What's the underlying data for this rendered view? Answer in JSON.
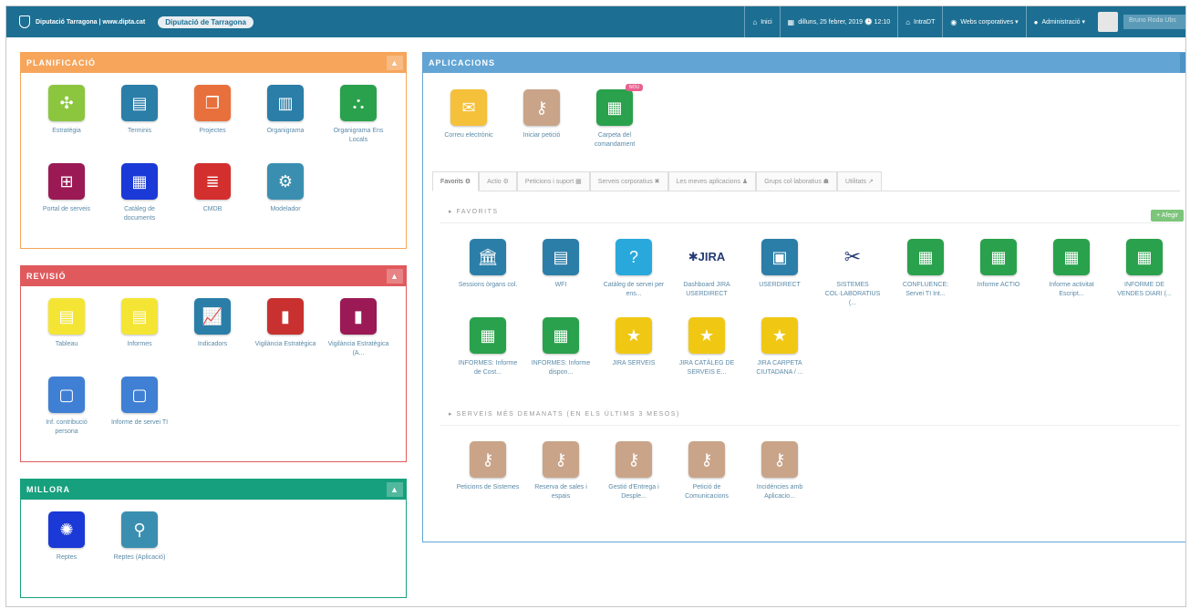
{
  "topbar": {
    "site_title": "Diputació Tarragona | www.dipta.cat",
    "pill": "Diputació de Tarragona",
    "nav": [
      {
        "icon": "home-icon",
        "label": "Inici"
      },
      {
        "icon": "calendar-icon",
        "label": "dilluns, 25 febrer, 2019 🕒 12:10"
      },
      {
        "icon": "home-icon",
        "label": "IntraDT"
      },
      {
        "icon": "globe-icon",
        "label": "Webs corporatives ▾"
      },
      {
        "icon": "user-icon",
        "label": "Administració ▾"
      }
    ],
    "user_name": "Bruno Roda Ubs"
  },
  "planificacio": {
    "title": "PLANIFICACIÓ",
    "items": [
      {
        "label": "Estratègia",
        "color": "#8cc63f",
        "icon": "✣"
      },
      {
        "label": "Terminis",
        "color": "#2b7ea8",
        "icon": "▤"
      },
      {
        "label": "Projectes",
        "color": "#e8703c",
        "icon": "❐"
      },
      {
        "label": "Organigrama",
        "color": "#2b7ea8",
        "icon": "▥"
      },
      {
        "label": "Organigrama Ens Locals",
        "color": "#2aa14c",
        "icon": "⛬"
      },
      {
        "label": "Portal de serveis",
        "color": "#9b1a55",
        "icon": "⊞"
      },
      {
        "label": "Catàleg de documents",
        "color": "#1a39d6",
        "icon": "▦"
      },
      {
        "label": "CMDB",
        "color": "#d42f2f",
        "icon": "≣"
      },
      {
        "label": "Modelador",
        "color": "#3a8fb0",
        "icon": "⚙"
      }
    ]
  },
  "revisio": {
    "title": "REVISIÓ",
    "items": [
      {
        "label": "Tableau",
        "color": "#f4e534",
        "icon": "▤"
      },
      {
        "label": "Informes",
        "color": "#f4e534",
        "icon": "▤"
      },
      {
        "label": "Indicadors",
        "color": "#2b7ea8",
        "icon": "📈"
      },
      {
        "label": "Vigilància Estratègica",
        "color": "#c8312f",
        "icon": "▮"
      },
      {
        "label": "Vigilància Estratègica (A...",
        "color": "#9b1a55",
        "icon": "▮"
      },
      {
        "label": "Inf. contribució persona",
        "color": "#3f7fd4",
        "icon": "▢"
      },
      {
        "label": "Informe de servei TI",
        "color": "#3f7fd4",
        "icon": "▢"
      }
    ]
  },
  "millora": {
    "title": "MILLORA",
    "items": [
      {
        "label": "Reptes",
        "color": "#1a39d6",
        "icon": "✺"
      },
      {
        "label": "Reptes (Aplicació)",
        "color": "#3a8fb0",
        "icon": "⚲"
      }
    ]
  },
  "aplicacions": {
    "title": "APLICACIONS",
    "top": [
      {
        "label": "Correu electrònic",
        "color": "#f5c03a",
        "icon": "✉"
      },
      {
        "label": "Iniciar petició",
        "color": "#c9a489",
        "icon": "⚷"
      },
      {
        "label": "Carpeta del comandament",
        "color": "#2aa14c",
        "icon": "▦",
        "badge": "NOU"
      }
    ],
    "tabs": [
      "Favorits ⚙",
      "Actio ⚙",
      "Peticions i suport ▦",
      "Serveis corporatius ✖",
      "Les meves aplicacions ♟",
      "Grups col·laboratius ☗",
      "Utilitats ↗"
    ],
    "favorits_title": "▸ FAVORITS",
    "add_label": "+ Afegir",
    "favorits": [
      {
        "label": "Sessions òrgans col.",
        "color": "#2b7ea8",
        "icon": "🏛",
        "kind": "box"
      },
      {
        "label": "WFI",
        "color": "#2b7ea8",
        "icon": "▤",
        "kind": "box"
      },
      {
        "label": "Catàleg de servei per ens...",
        "color": "#29a8dc",
        "icon": "?",
        "kind": "box"
      },
      {
        "label": "Dashboard JIRA USERDIRECT",
        "color": "",
        "icon": "⚡JIRA",
        "kind": "jira"
      },
      {
        "label": "USERDIRECT",
        "color": "#2b7ea8",
        "icon": "▣",
        "kind": "box"
      },
      {
        "label": "SISTEMES COL·LABORATIUS (...",
        "color": "",
        "icon": "✂",
        "kind": "conf"
      },
      {
        "label": "CONFLUENCE: Servei TI Int...",
        "color": "#2aa14c",
        "icon": "▦",
        "kind": "box"
      },
      {
        "label": "Informe ACTIO",
        "color": "#2aa14c",
        "icon": "▦",
        "kind": "box"
      },
      {
        "label": "Informe activitat Escript...",
        "color": "#2aa14c",
        "icon": "▦",
        "kind": "box"
      },
      {
        "label": "INFORME DE VENDES DIARI (...",
        "color": "#2aa14c",
        "icon": "▦",
        "kind": "box"
      },
      {
        "label": "INFORMES: Informe de Cost...",
        "color": "#2aa14c",
        "icon": "▦",
        "kind": "box"
      },
      {
        "label": "INFORMES: Informe dispon...",
        "color": "#2aa14c",
        "icon": "▦",
        "kind": "box"
      },
      {
        "label": "JIRA SERVEIS",
        "color": "#f0c814",
        "icon": "★",
        "kind": "box"
      },
      {
        "label": "JIRA CATÀLEG DE SERVEIS E...",
        "color": "#f0c814",
        "icon": "★",
        "kind": "box"
      },
      {
        "label": "JIRA CARPETA CIUTADANA / ...",
        "color": "#f0c814",
        "icon": "★",
        "kind": "box"
      }
    ],
    "demanats_title": "▸ SERVEIS MÉS DEMANATS (EN ELS ÚLTIMS 3 MESOS)",
    "demanats": [
      {
        "label": "Peticions de Sistemes",
        "color": "#c9a489",
        "icon": "⚷"
      },
      {
        "label": "Reserva de sales i espais",
        "color": "#c9a489",
        "icon": "⚷"
      },
      {
        "label": "Gestió d'Entrega i Desple...",
        "color": "#c9a489",
        "icon": "⚷"
      },
      {
        "label": "Petició de Comunicacions",
        "color": "#c9a489",
        "icon": "⚷"
      },
      {
        "label": "Incidències amb Aplicacio...",
        "color": "#c9a489",
        "icon": "⚷"
      }
    ]
  }
}
